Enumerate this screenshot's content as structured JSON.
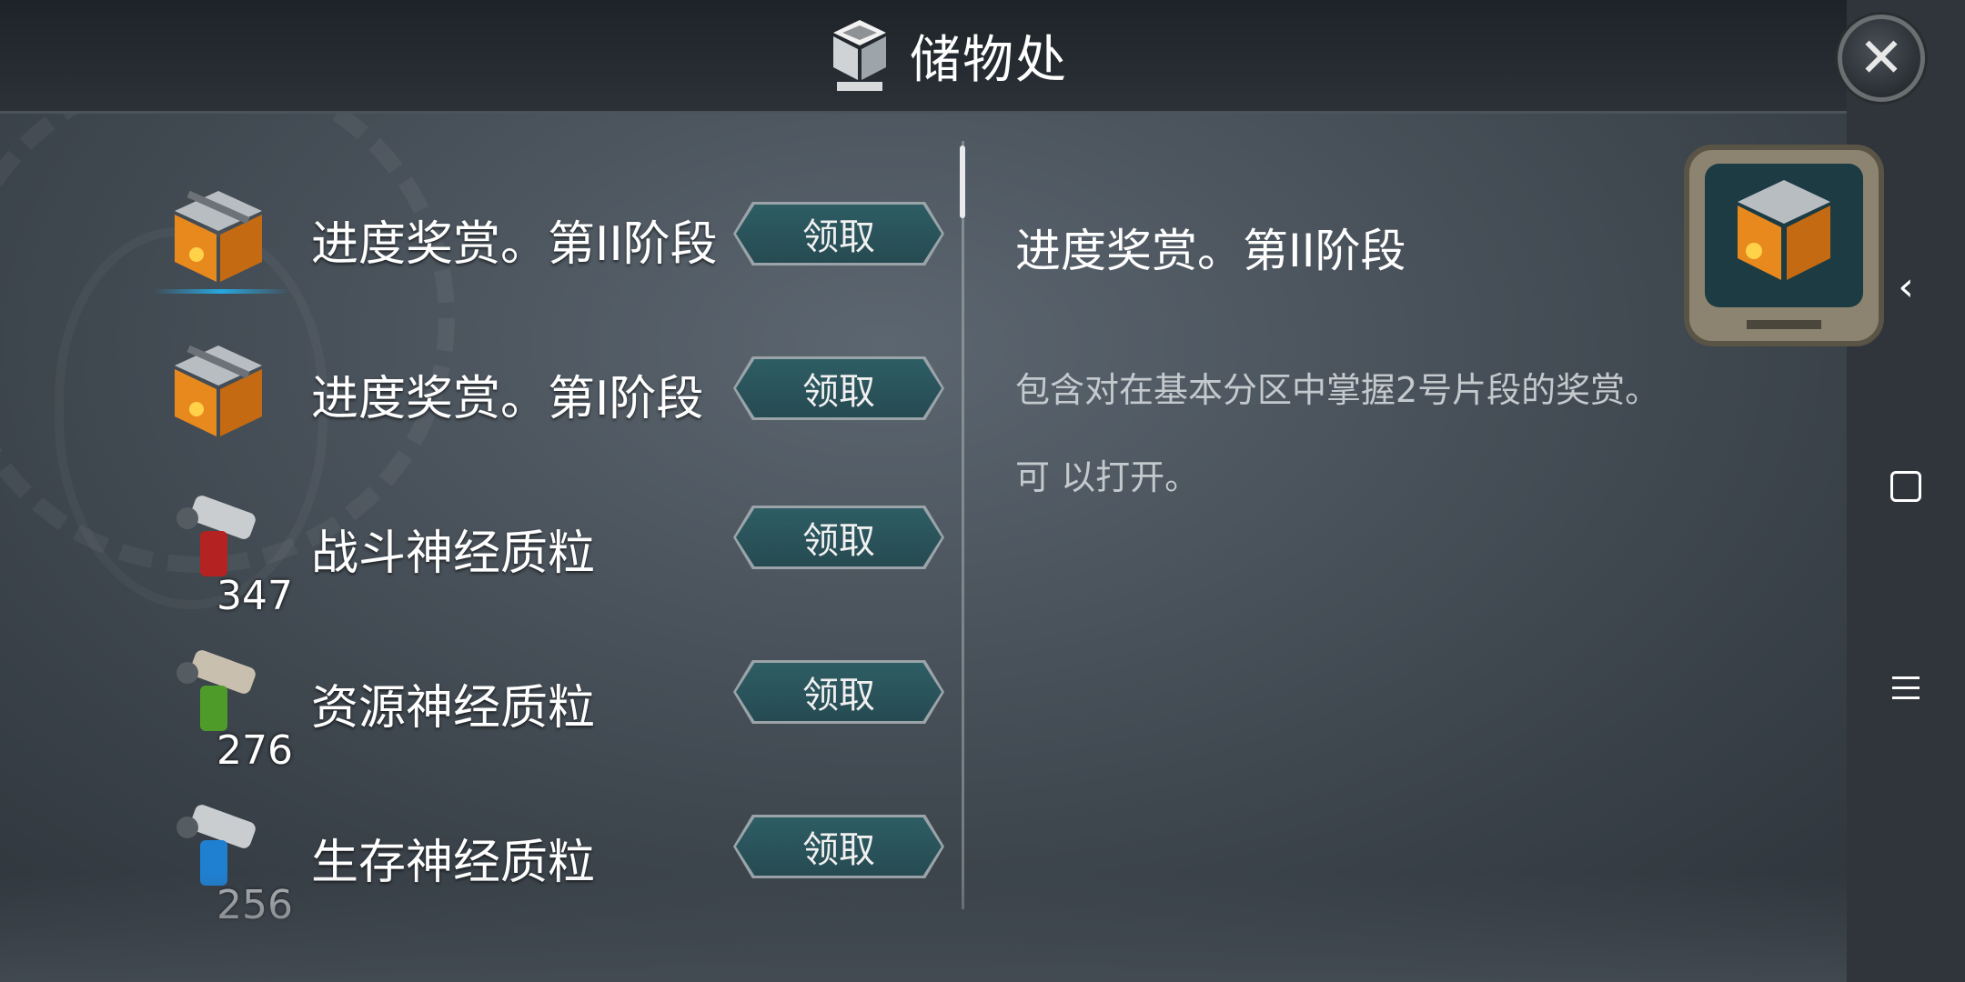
{
  "header": {
    "title": "储物处",
    "close_icon": "close-icon",
    "title_icon": "storage-cube-icon"
  },
  "list": {
    "items": [
      {
        "name": "进度奖赏。第II阶段",
        "icon": "orange-crate-icon",
        "count": "",
        "claim_label": "领取",
        "selected": true
      },
      {
        "name": "进度奖赏。第I阶段",
        "icon": "orange-crate-icon",
        "count": "",
        "claim_label": "领取",
        "selected": false
      },
      {
        "name": "战斗神经质粒",
        "icon": "red-injector-icon",
        "count": "347",
        "claim_label": "领取",
        "selected": false
      },
      {
        "name": "资源神经质粒",
        "icon": "green-injector-icon",
        "count": "276",
        "claim_label": "领取",
        "selected": false
      },
      {
        "name": "生存神经质粒",
        "icon": "blue-injector-icon",
        "count": "256",
        "claim_label": "领取",
        "selected": false
      }
    ]
  },
  "detail": {
    "title": "进度奖赏。第II阶段",
    "description": "包含对在基本分区中掌握2号片段的奖赏。",
    "note": "可 以打开。",
    "preview_icon": "crate-monitor-icon"
  },
  "system_nav": {
    "back": "back-icon",
    "home": "home-icon",
    "menu": "menu-icon"
  },
  "colors": {
    "button_fill": "#2e5d64",
    "selected_accent": "#26a8e0",
    "background": "#3e464e"
  }
}
